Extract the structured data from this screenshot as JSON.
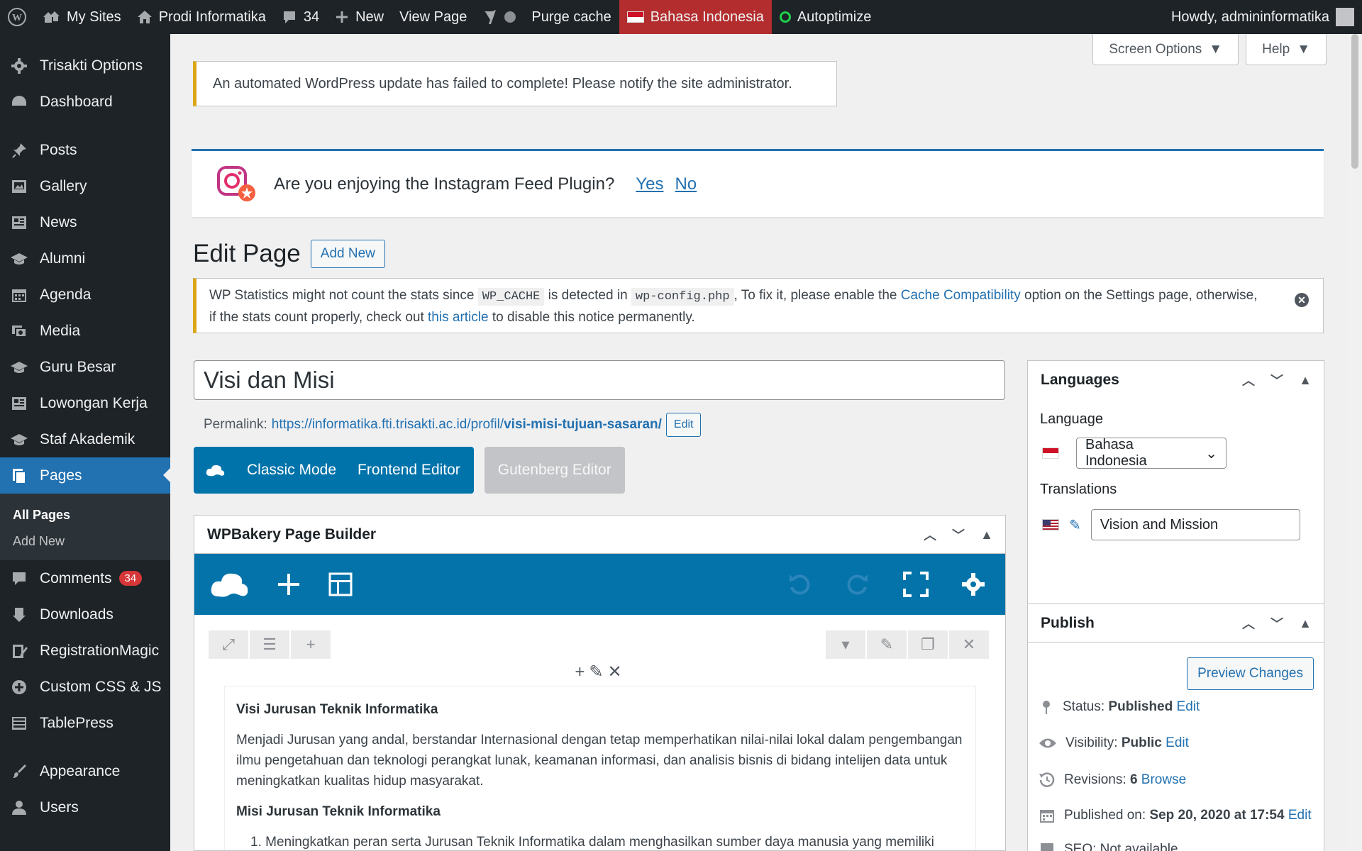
{
  "adminbar": {
    "my_sites": "My Sites",
    "site_name": "Prodi Informatika",
    "comments_count": "34",
    "new_label": "New",
    "view_page": "View Page",
    "purge_cache": "Purge cache",
    "language": "Bahasa Indonesia",
    "autoptimize": "Autoptimize",
    "howdy": "Howdy, admininformatika"
  },
  "sidebar": {
    "items": [
      {
        "label": "Trisakti Options",
        "icon": "gear-icon"
      },
      {
        "label": "Dashboard",
        "icon": "dashboard-icon"
      },
      {
        "label": "Posts",
        "icon": "pin-icon"
      },
      {
        "label": "Gallery",
        "icon": "gallery-icon"
      },
      {
        "label": "News",
        "icon": "news-icon"
      },
      {
        "label": "Alumni",
        "icon": "mortarboard-icon"
      },
      {
        "label": "Agenda",
        "icon": "calendar-icon"
      },
      {
        "label": "Media",
        "icon": "media-icon"
      },
      {
        "label": "Guru Besar",
        "icon": "mortarboard-icon"
      },
      {
        "label": "Lowongan Kerja",
        "icon": "news-icon"
      },
      {
        "label": "Staf Akademik",
        "icon": "mortarboard-icon"
      },
      {
        "label": "Pages",
        "icon": "pages-icon"
      },
      {
        "label": "Comments",
        "icon": "comment-icon",
        "badge": "34"
      },
      {
        "label": "Downloads",
        "icon": "download-icon"
      },
      {
        "label": "RegistrationMagic",
        "icon": "registration-icon"
      },
      {
        "label": "Custom CSS & JS",
        "icon": "plus-circle-icon"
      },
      {
        "label": "TablePress",
        "icon": "table-icon"
      },
      {
        "label": "Appearance",
        "icon": "brush-icon"
      },
      {
        "label": "Users",
        "icon": "user-icon"
      }
    ],
    "submenu": [
      "All Pages",
      "Add New"
    ]
  },
  "screen_options": {
    "screen": "Screen Options",
    "help": "Help"
  },
  "notices": {
    "update_failed": "An automated WordPress update has failed to complete! Please notify the site administrator.",
    "instagram_question": "Are you enjoying the Instagram Feed Plugin?",
    "instagram_yes": "Yes",
    "instagram_no": "No",
    "stats_1": "WP Statistics might not count the stats since",
    "stats_code_1": "WP_CACHE",
    "stats_2": "is detected in",
    "stats_code_2": "wp-config.php",
    "stats_3": ", To fix it, please enable the",
    "stats_link_1": "Cache Compatibility",
    "stats_4": "option on the Settings page, otherwise, if the stats count properly, check out",
    "stats_link_2": "this article",
    "stats_5": "to disable this notice permanently."
  },
  "page": {
    "heading": "Edit Page",
    "add_new": "Add New",
    "title_value": "Visi dan Misi",
    "permalink_label": "Permalink:",
    "permalink_base": "https://informatika.fti.trisakti.ac.id/profil/",
    "permalink_slug": "visi-misi-tujuan-sasaran/",
    "permalink_edit": "Edit"
  },
  "builder": {
    "classic_mode": "Classic Mode",
    "frontend_editor": "Frontend Editor",
    "gutenberg_editor": "Gutenberg Editor",
    "panel_title": "WPBakery Page Builder"
  },
  "content": {
    "visi_heading": "Visi Jurusan Teknik Informatika",
    "visi_text": "Menjadi Jurusan yang andal, berstandar Internasional dengan tetap memperhatikan nilai-nilai lokal dalam pengembangan ilmu pengetahuan dan teknologi perangkat lunak, keamanan informasi, dan analisis bisnis di bidang intelijen data untuk meningkatkan kualitas hidup masyarakat.",
    "misi_heading": "Misi Jurusan Teknik Informatika",
    "misi_item_1": "1. Meningkatkan peran serta Jurusan Teknik Informatika dalam menghasilkan sumber daya manusia yang memiliki"
  },
  "languages_box": {
    "title": "Languages",
    "language_label": "Language",
    "language_value": "Bahasa Indonesia",
    "translations_label": "Translations",
    "translation_value": "Vision and Mission"
  },
  "publish_box": {
    "title": "Publish",
    "preview": "Preview Changes",
    "status_label": "Status:",
    "status_value": "Published",
    "visibility_label": "Visibility:",
    "visibility_value": "Public",
    "revisions_label": "Revisions:",
    "revisions_value": "6",
    "browse": "Browse",
    "published_label": "Published on:",
    "published_value": "Sep 20, 2020 at 17:54",
    "edit": "Edit",
    "seo_partial": "SEO: Not available"
  },
  "colors": {
    "admin_dark": "#1d2327",
    "accent_blue": "#2271b1",
    "wpbakery_blue": "#0473aa",
    "warning_yellow": "#dba617",
    "active_language_red": "#b32d2e"
  }
}
